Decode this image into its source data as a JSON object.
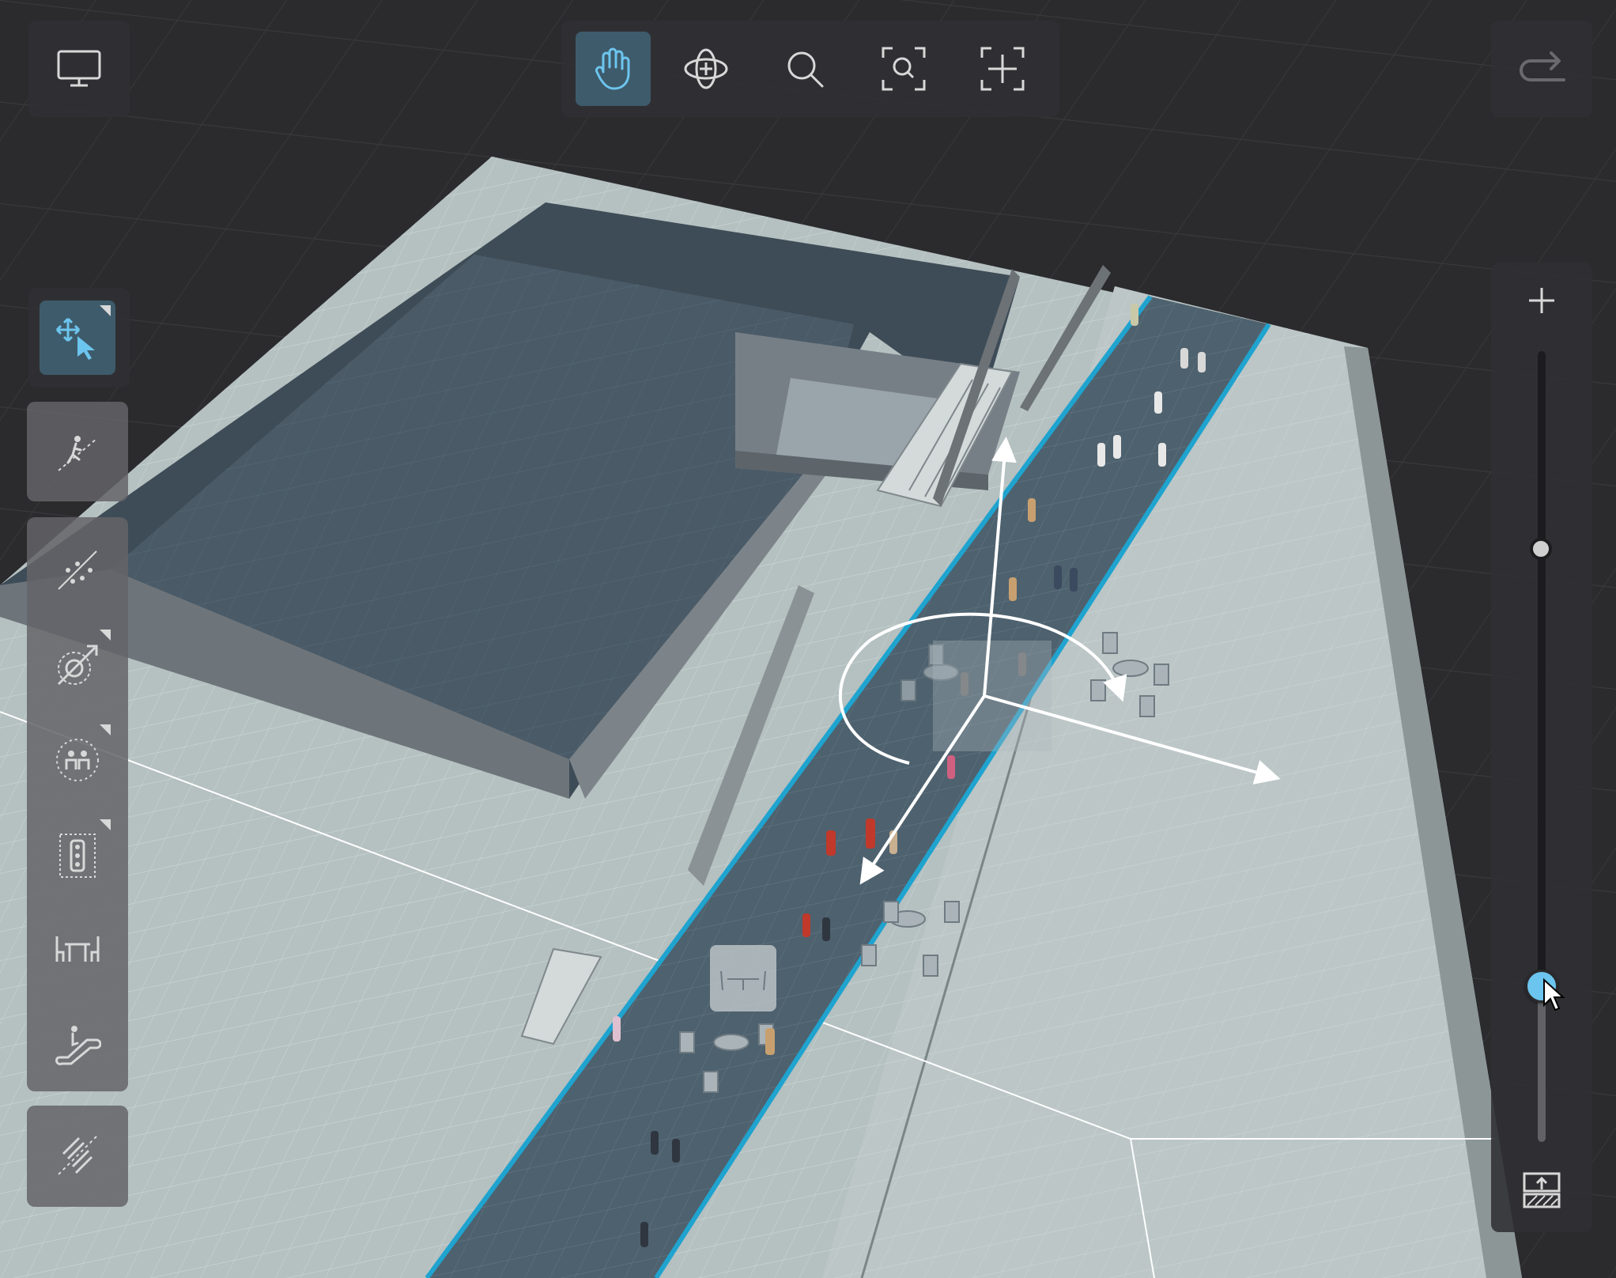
{
  "viewport": {
    "accent_color": "#6cc5ee",
    "active_button_color": "#3e5b6b",
    "path_edge_color": "#1fa3cf"
  },
  "top_toolbar": {
    "tools": [
      {
        "name": "pan",
        "icon": "hand-icon",
        "active": true
      },
      {
        "name": "orbit",
        "icon": "orbit-icon",
        "active": false
      },
      {
        "name": "zoom",
        "icon": "magnifier-icon",
        "active": false
      },
      {
        "name": "zoom-to-selection",
        "icon": "focus-magnifier-icon",
        "active": false
      },
      {
        "name": "frame-all",
        "icon": "frame-icon",
        "active": false
      }
    ]
  },
  "top_left": {
    "icon": "monitor-icon"
  },
  "top_right": {
    "icon": "redo-icon"
  },
  "left_toolbar": {
    "tools": [
      {
        "name": "select-move",
        "icon": "move-select-icon",
        "active": true
      },
      {
        "name": "pedestrian-path",
        "icon": "walker-path-icon"
      },
      {
        "name": "pedestrian-flow",
        "icon": "dots-line-icon"
      },
      {
        "name": "target-area",
        "icon": "target-arrow-icon"
      },
      {
        "name": "group-spawn",
        "icon": "group-people-icon"
      },
      {
        "name": "signal-area",
        "icon": "traffic-light-icon"
      },
      {
        "name": "seating",
        "icon": "table-chairs-icon"
      },
      {
        "name": "escalator",
        "icon": "escalator-icon"
      },
      {
        "name": "measure",
        "icon": "ruler-line-icon"
      }
    ]
  },
  "zoom_slider": {
    "level": 0.2,
    "zoom_in_icon": "plus-icon",
    "bottom_icon": "floor-level-icon"
  }
}
